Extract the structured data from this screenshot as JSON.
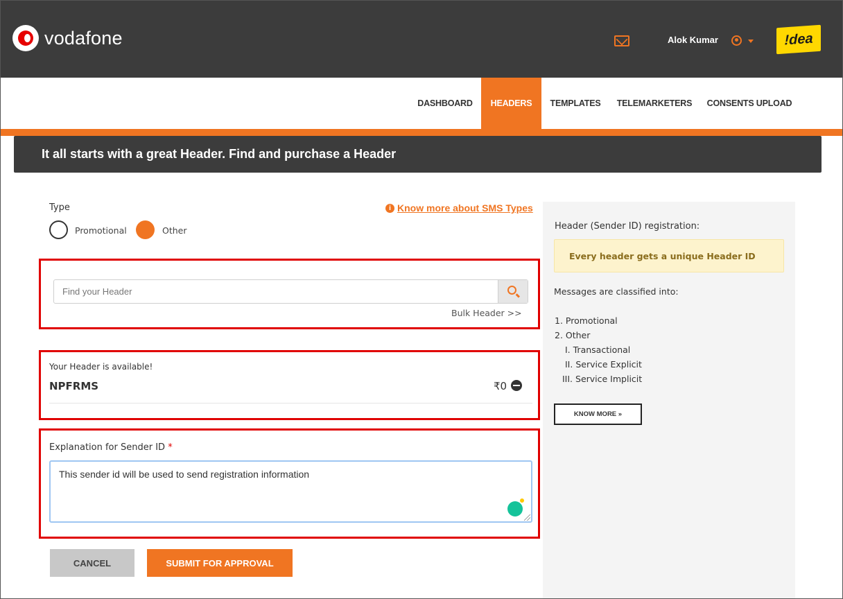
{
  "header": {
    "brand": "vodafone",
    "user_name": "Alok Kumar",
    "partner_logo": "!dea"
  },
  "nav": {
    "items": [
      {
        "label": "DASHBOARD",
        "active": false
      },
      {
        "label": "HEADERS",
        "active": true
      },
      {
        "label": "TEMPLATES",
        "active": false
      },
      {
        "label": "TELEMARKETERS",
        "active": false
      },
      {
        "label": "CONSENTS UPLOAD",
        "active": false
      }
    ]
  },
  "page": {
    "title": "It all starts with a great Header. Find and purchase a Header"
  },
  "form": {
    "type_label": "Type",
    "radio_promotional": "Promotional",
    "radio_other": "Other",
    "selected_type": "Other",
    "info_link": "Know more about SMS Types",
    "search_placeholder": "Find your Header",
    "bulk_link": "Bulk Header >>",
    "available_label": "Your Header is available!",
    "header_name": "NPFRMS",
    "price": "₹0",
    "explanation_label": "Explanation for Sender ID",
    "required_mark": "*",
    "explanation_value": "This sender id will be used to send registration information",
    "cancel_label": "CANCEL",
    "submit_label": "SUBMIT FOR APPROVAL"
  },
  "sidebar": {
    "title": "Header (Sender ID) registration:",
    "note": "Every header gets a unique Header ID",
    "classified_label": "Messages are classified into:",
    "list": [
      "1. Promotional",
      "2. Other",
      "I. Transactional",
      "II. Service Explicit",
      "III. Service Implicit"
    ],
    "know_more_label": "KNOW MORE »"
  },
  "colors": {
    "accent": "#f07522",
    "dark_bar": "#3c3c3c",
    "highlight_box": "#e00000"
  },
  "icons": [
    "mail-icon",
    "user-icon",
    "caret-down-icon",
    "info-icon",
    "search-icon",
    "remove-icon",
    "grammarly-icon",
    "resize-handle-icon"
  ]
}
